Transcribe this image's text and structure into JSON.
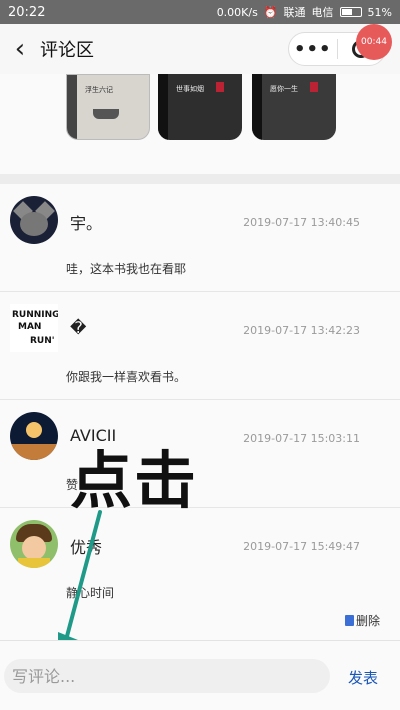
{
  "status_bar": {
    "time": "20:22",
    "speed": "0.00K/s",
    "carrier_1": "联通",
    "carrier_2": "电信",
    "battery": "51%"
  },
  "nav": {
    "title": "评论区",
    "more_icon": "•••",
    "record_badge": "00:44"
  },
  "books": [
    {
      "title": "浮生六记"
    },
    {
      "title": "世事如烟"
    },
    {
      "title": "愿你一生"
    }
  ],
  "comments": [
    {
      "user": "宇。",
      "time": "2019-07-17 13:40:45",
      "text": "哇，这本书我也在看耶"
    },
    {
      "user": "�",
      "time": "2019-07-17 13:42:23",
      "text": "你跟我一样喜欢看书。"
    },
    {
      "user": "AVICII",
      "time": "2019-07-17 15:03:11",
      "text": "赞"
    },
    {
      "user": "优秀",
      "time": "2019-07-17 15:49:47",
      "text": "静心时间"
    }
  ],
  "avatar_2_text": [
    "RUNNING",
    "MAN",
    "RUN'"
  ],
  "delete_label": "删除",
  "overlay_label": "点击",
  "input": {
    "placeholder": "写评论..."
  },
  "publish_label": "发表",
  "colors": {
    "publish": "#1a56b8",
    "arrow": "#1f9a88"
  }
}
